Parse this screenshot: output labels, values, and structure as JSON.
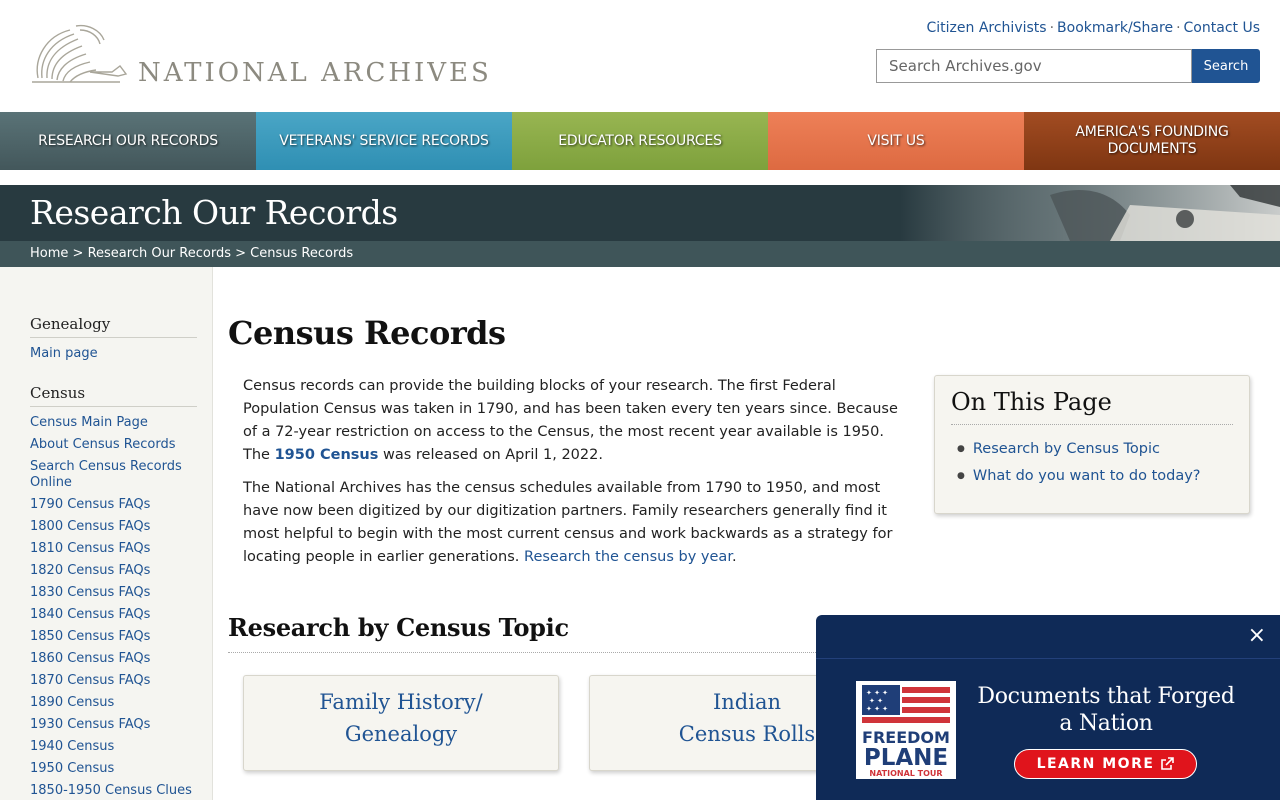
{
  "header": {
    "logo_text": "NATIONAL ARCHIVES",
    "top_links": [
      "Citizen Archivists",
      "Bookmark/Share",
      "Contact Us"
    ],
    "search_placeholder": "Search Archives.gov",
    "search_button": "Search"
  },
  "nav": [
    {
      "label": "RESEARCH OUR RECORDS",
      "color": "#4e6569"
    },
    {
      "label": "VETERANS' SERVICE RECORDS",
      "color": "#3b9bbe"
    },
    {
      "label": "EDUCATOR RESOURCES",
      "color": "#8cab47"
    },
    {
      "label": "VISIT US",
      "color": "#e6754c"
    },
    {
      "label": "AMERICA'S FOUNDING DOCUMENTS",
      "color": "#913f17"
    }
  ],
  "banner": {
    "title": "Research Our Records"
  },
  "breadcrumb": {
    "items": [
      "Home",
      "Research Our Records",
      "Census Records"
    ],
    "separator": ">"
  },
  "sidebar": {
    "genealogy": {
      "heading": "Genealogy",
      "links": [
        "Main page"
      ]
    },
    "census": {
      "heading": "Census",
      "links": [
        "Census Main Page",
        "About Census Records",
        "Search Census Records Online",
        "1790 Census FAQs",
        "1800 Census FAQs",
        "1810 Census FAQs",
        "1820 Census FAQs",
        "1830 Census FAQs",
        "1840 Census FAQs",
        "1850 Census FAQs",
        "1860 Census FAQs",
        "1870 Census FAQs",
        "1890 Census",
        "1930 Census FAQs",
        "1940 Census",
        "1950 Census",
        "1850-1950 Census Clues"
      ]
    }
  },
  "main": {
    "title": "Census Records",
    "p1_a": "Census records can provide the building blocks of your research.  The first Federal Population Census was taken in 1790, and has been taken every ten years since.  Because of a 72-year restriction on access to the Census, the most recent year available is 1950. The ",
    "p1_link": "1950 Census",
    "p1_b": " was released on April 1, 2022.",
    "p2_a": "The National Archives has the census schedules available from 1790 to 1950, and most have now been digitized by our digitization partners. Family researchers generally find it most helpful to begin with the most current census and work backwards as a strategy for locating people in earlier generations. ",
    "p2_link": "Research the census by year",
    "p2_b": "."
  },
  "on_this_page": {
    "title": "On This Page",
    "links": [
      "Research by Census Topic",
      "What do you want to do today?"
    ]
  },
  "topics": {
    "heading": "Research by Census Topic",
    "cards": [
      {
        "line1": "Family History/",
        "line2": "Genealogy"
      },
      {
        "line1": "Indian",
        "line2": "Census Rolls"
      }
    ]
  },
  "promo": {
    "close": "×",
    "logo_line1": "FREEDOM",
    "logo_line2": "PLANE",
    "logo_line3": "NATIONAL TOUR",
    "headline": "Documents that Forged a Nation",
    "button": "LEARN MORE"
  }
}
